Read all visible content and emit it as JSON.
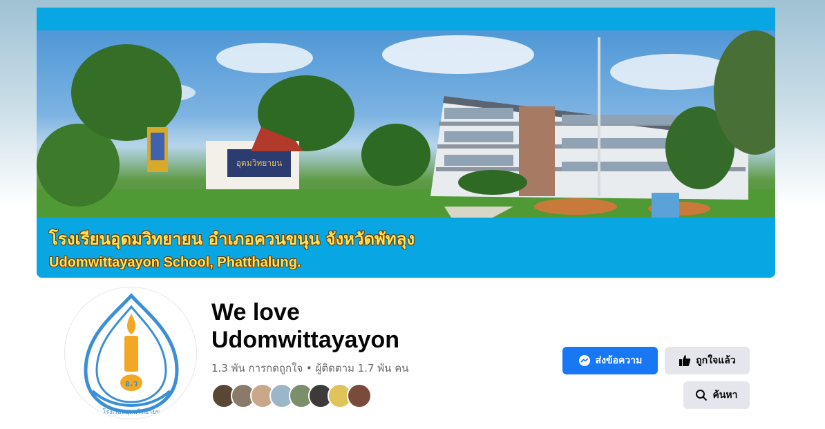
{
  "cover": {
    "caption_thai": "โรงเรียนอุดมวิทยายน อำเภอควนขนุน จังหวัดพัทลุง",
    "caption_english": "Udomwittayayon School, Phatthalung.",
    "sign_text": "อุดมวิทยายน",
    "accent_color": "#08a6e2"
  },
  "avatar": {
    "logo_text": "โรงเรียนอุดมวิทยายน",
    "logo_badge": "อ.ว"
  },
  "page": {
    "title": "We love Udomwittayayon",
    "stats": "1.3 พัน การกดถูกใจ • ผู้ติดตาม 1.7 พัน คน"
  },
  "followers": {
    "colors": [
      "#5a4634",
      "#8a7a6a",
      "#c9a88a",
      "#9bb6c9",
      "#7b8f6a",
      "#3c3a3a",
      "#e0c35a",
      "#7a4a3a"
    ]
  },
  "actions": {
    "message_label": "ส่งข้อความ",
    "liked_label": "ถูกใจแล้ว",
    "search_label": "ค้นหา",
    "primary_color": "#1877f2"
  }
}
